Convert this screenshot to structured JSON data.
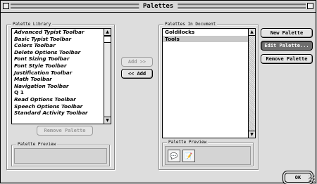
{
  "window": {
    "title": "Palettes"
  },
  "library": {
    "group_label": "Palette Library",
    "items": [
      "Advanced Typist Toolbar",
      "Basic Typist Toolbar",
      "Colors Toolbar",
      "Delete Options Toolbar",
      "Font Sizing Toolbar",
      "Font Style Toolbar",
      "Justification Toolbar",
      "Math Toolbar",
      "Navigation Toolbar",
      "Q 1",
      "Read Options Toolbar",
      "Speech Options Toolbar",
      "Standard Activity Toolbar"
    ],
    "remove_button": "Remove Palette",
    "preview_label": "Palette Preview"
  },
  "middle": {
    "add_button": "Add >>",
    "remove_button": "<< Add"
  },
  "document": {
    "group_label": "Palettes In Document",
    "items": [
      "Goldilocks",
      "Tools"
    ],
    "selected": "Tools",
    "preview_label": "Palette Preview",
    "preview_icons": [
      "speech-bubble-icon",
      "document-pen-icon"
    ]
  },
  "actions": {
    "new_palette": "New Palette",
    "edit_palette": "Edit Palette...",
    "remove_palette": "Remove Palette"
  },
  "footer": {
    "ok_button": "OK"
  }
}
